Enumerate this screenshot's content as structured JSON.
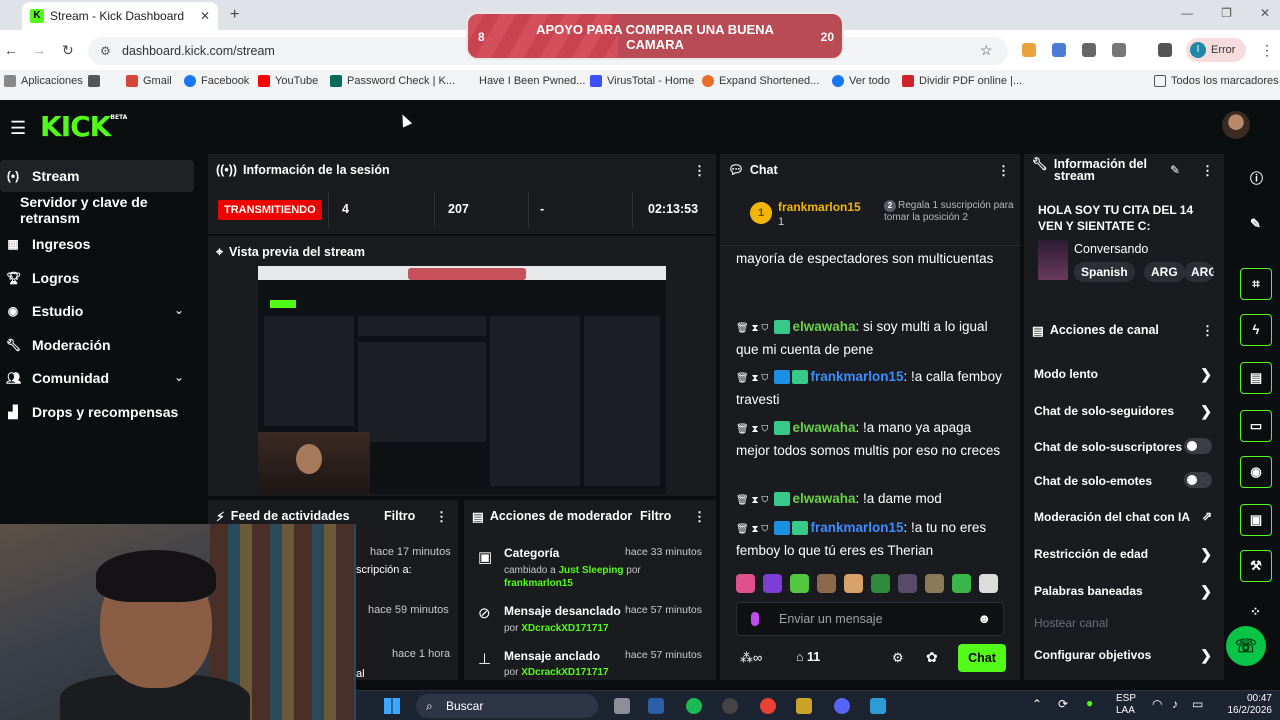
{
  "browser": {
    "tab_title": "Stream - Kick Dashboard",
    "url": "dashboard.kick.com/stream",
    "error_label": "Error",
    "profile_initial": "I",
    "bookmarks": [
      "Aplicaciones",
      "Gmail",
      "Facebook",
      "YouTube",
      "Password Check | K...",
      "Have I Been Pwned...",
      "VirusTotal - Home",
      "Expand Shortened...",
      "Ver todo",
      "Dividir PDF online |...",
      "Todos los marcadores"
    ]
  },
  "goal_banner": {
    "text": "APOYO PARA COMPRAR UNA BUENA CAMARA",
    "current": "8",
    "target": "20",
    "progress": 0.4
  },
  "kick": {
    "logo": "KICK",
    "logo_badge": "BETA"
  },
  "sidebar": {
    "items": [
      {
        "label": "Stream"
      },
      {
        "label": "Servidor y clave de retransm"
      },
      {
        "label": "Ingresos"
      },
      {
        "label": "Logros"
      },
      {
        "label": "Estudio"
      },
      {
        "label": "Moderación"
      },
      {
        "label": "Comunidad"
      },
      {
        "label": "Drops y recompensas"
      }
    ]
  },
  "session": {
    "title": "Información de la sesión",
    "status": "TRANSMITIENDO",
    "viewers": "4",
    "followers": "207",
    "subs": "-",
    "duration": "02:13:53"
  },
  "preview": {
    "title": "Vista previa del stream"
  },
  "feed": {
    "title": "Feed de actividades",
    "filter": "Filtro",
    "rows": [
      {
        "time": "hace 17 minutos",
        "text": "scripción a:"
      },
      {
        "time": "hace 59 minutos",
        "text": ""
      },
      {
        "time": "hace 1 hora",
        "text": "al"
      }
    ]
  },
  "mod_actions": {
    "title": "Acciones de moderador",
    "filter": "Filtro",
    "rows": [
      {
        "title": "Categoría",
        "time": "hace 33 minutos",
        "sub_pre": "cambiado a ",
        "sub_hl": "Just Sleeping",
        "sub_mid": " por ",
        "sub_user": "frankmarlon15"
      },
      {
        "title": "Mensaje desanclado",
        "time": "hace 57 minutos",
        "sub_pre": "por ",
        "sub_user": "XDcrackXD171717"
      },
      {
        "title": "Mensaje anclado",
        "time": "hace 57 minutos",
        "sub_pre": "por ",
        "sub_user": "XDcrackXD171717"
      }
    ]
  },
  "chat": {
    "title": "Chat",
    "top_gifter": {
      "rank": "1",
      "name": "frankmarlon15",
      "count": "1"
    },
    "gift_prompt": "Regala 1 suscripción para tomar la posición 2",
    "gift_rank": "2",
    "messages": [
      {
        "user": "",
        "text": "mayoría de espectadores son multicuentas"
      },
      {
        "user": "elwawaha",
        "color": "green",
        "text": "si soy multi a lo igual que mi cuenta de pene"
      },
      {
        "user": "frankmarlon15",
        "color": "blue",
        "text": "!a calla femboy travesti"
      },
      {
        "user": "elwawaha",
        "color": "green",
        "text": "!a mano ya apaga mejor todos somos multis por eso no creces"
      },
      {
        "user": "elwawaha",
        "color": "green",
        "text": "!a dame mod"
      },
      {
        "user": "frankmarlon15",
        "color": "blue",
        "text": "!a tu no eres femboy lo que tú eres es Therian"
      }
    ],
    "input_placeholder": "Enviar un mensaje",
    "viewer_count": "11",
    "send_label": "Chat"
  },
  "stream_info": {
    "title": "Información del stream",
    "stream_title": "HOLA SOY TU CITA DEL 14 VEN Y SIENTATE C:",
    "category": "Conversando",
    "tags": [
      "Spanish",
      "ARG",
      "ARG"
    ]
  },
  "channel_actions": {
    "title": "Acciones de canal",
    "items": [
      {
        "label": "Modo lento",
        "control": "arrow"
      },
      {
        "label": "Chat de solo-seguidores",
        "control": "arrow"
      },
      {
        "label": "Chat de solo-suscriptores",
        "control": "toggle"
      },
      {
        "label": "Chat de solo-emotes",
        "control": "toggle"
      },
      {
        "label": "Moderación del chat con IA",
        "control": "external"
      },
      {
        "label": "Restricción de edad",
        "control": "arrow"
      },
      {
        "label": "Palabras baneadas",
        "control": "arrow"
      },
      {
        "label": "Hostear canal",
        "control": "disabled"
      },
      {
        "label": "Configurar objetivos",
        "control": "arrow"
      }
    ]
  },
  "taskbar": {
    "search": "Buscar",
    "lang": "ESP",
    "region": "LAA",
    "time": "00:47",
    "date": "16/2/2026"
  },
  "colors": {
    "kick_green": "#53fc18",
    "live_red": "#eb0400",
    "panel_bg": "#191b1f",
    "page_bg": "#0b0e0f"
  }
}
